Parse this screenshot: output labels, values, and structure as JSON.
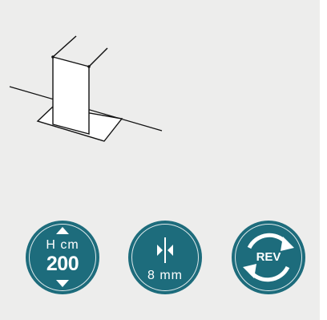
{
  "colors": {
    "background": "#ededec",
    "badge": "#1d6c7c",
    "line": "#111111",
    "panel": "#ffffff"
  },
  "badges": {
    "height": {
      "label": "H cm",
      "value": "200",
      "icon_up": "triangle-up-icon",
      "icon_down": "triangle-down-icon"
    },
    "thickness": {
      "label": "8 mm",
      "icon": "glass-thickness-icon"
    },
    "reversible": {
      "label": "REV",
      "icon": "reversible-arrows-icon"
    }
  },
  "illustration": {
    "icon": "walk-in-shower-panel-icon"
  }
}
